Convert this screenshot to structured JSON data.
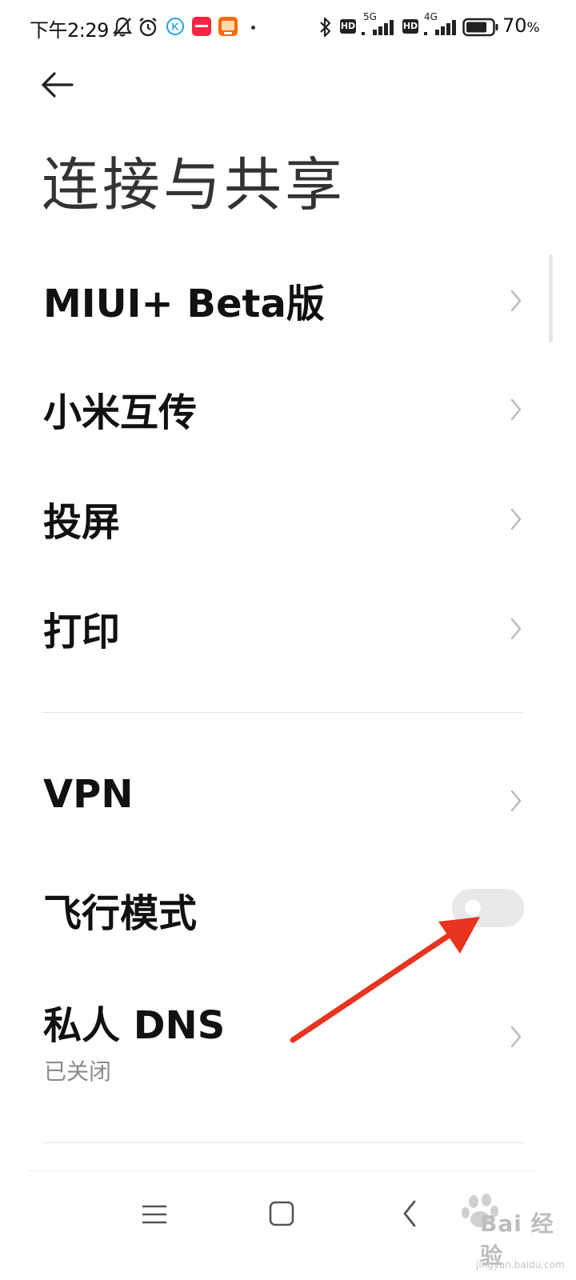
{
  "status_bar": {
    "time": "下午2:29",
    "net1": "5G",
    "net2": "4G",
    "hd": "HD",
    "battery_pct": "70",
    "battery_unit": "%"
  },
  "header": {
    "title": "连接与共享"
  },
  "items": [
    {
      "label": "MIUI+ Beta版"
    },
    {
      "label": "小米互传"
    },
    {
      "label": "投屏"
    },
    {
      "label": "打印"
    },
    {
      "label": "VPN"
    },
    {
      "label": "飞行模式"
    },
    {
      "label": "私人 DNS",
      "sub": "已关闭"
    }
  ],
  "airplane_mode": {
    "enabled": false
  },
  "watermark": {
    "brand": "Bai  经验",
    "url": "jingyan.baidu.com"
  },
  "colors": {
    "annotation_arrow": "#e8331f",
    "toggle_off": "#e8e8e8"
  }
}
